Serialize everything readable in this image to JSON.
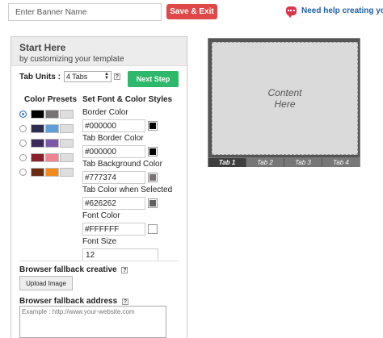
{
  "header": {
    "banner_placeholder": "Enter Banner Name",
    "save_label": "Save & Exit",
    "help_label": "Need help creating your c"
  },
  "panel": {
    "title": "Start Here",
    "subtitle": "by customizing your template",
    "tab_units_label": "Tab Units :",
    "tab_units_value": "4 Tabs",
    "help_mark": "?",
    "next_label": "Next Step",
    "presets_title": "Color Presets",
    "presets": [
      {
        "checked": true,
        "colors": [
          "#000000",
          "#777374",
          "#dedede"
        ]
      },
      {
        "checked": false,
        "colors": [
          "#2c2d4f",
          "#5f9fd8",
          "#dedede"
        ]
      },
      {
        "checked": false,
        "colors": [
          "#3a2a59",
          "#7b58a8",
          "#dedede"
        ]
      },
      {
        "checked": false,
        "colors": [
          "#8b1f2b",
          "#f08592",
          "#dedede"
        ]
      },
      {
        "checked": false,
        "colors": [
          "#6b2b10",
          "#f28c1f",
          "#dedede"
        ]
      }
    ],
    "styles_title": "Set Font & Color Styles",
    "fields": [
      {
        "label": "Border Color",
        "value": "#000000",
        "swatch": "#000000"
      },
      {
        "label": "Tab Border Color",
        "value": "#000000",
        "swatch": "#000000"
      },
      {
        "label": "Tab Background Color",
        "value": "#777374",
        "swatch": "#777374"
      },
      {
        "label": "Tab Color when Selected",
        "value": "#626262",
        "swatch": "#626262"
      },
      {
        "label": "Font Color",
        "value": "#FFFFFF",
        "swatch": "#FFFFFF"
      }
    ],
    "font_size_label": "Font Size",
    "font_size_value": "12",
    "fallback_creative_label": "Browser fallback creative",
    "upload_label": "Upload Image",
    "fallback_address_label": "Browser fallback address",
    "address_placeholder": "Example : http://www.your-website.com"
  },
  "preview": {
    "content_line1": "Content",
    "content_line2": "Here",
    "tabs": [
      "Tab 1",
      "Tab 2",
      "Tab 3",
      "Tab 4"
    ]
  }
}
